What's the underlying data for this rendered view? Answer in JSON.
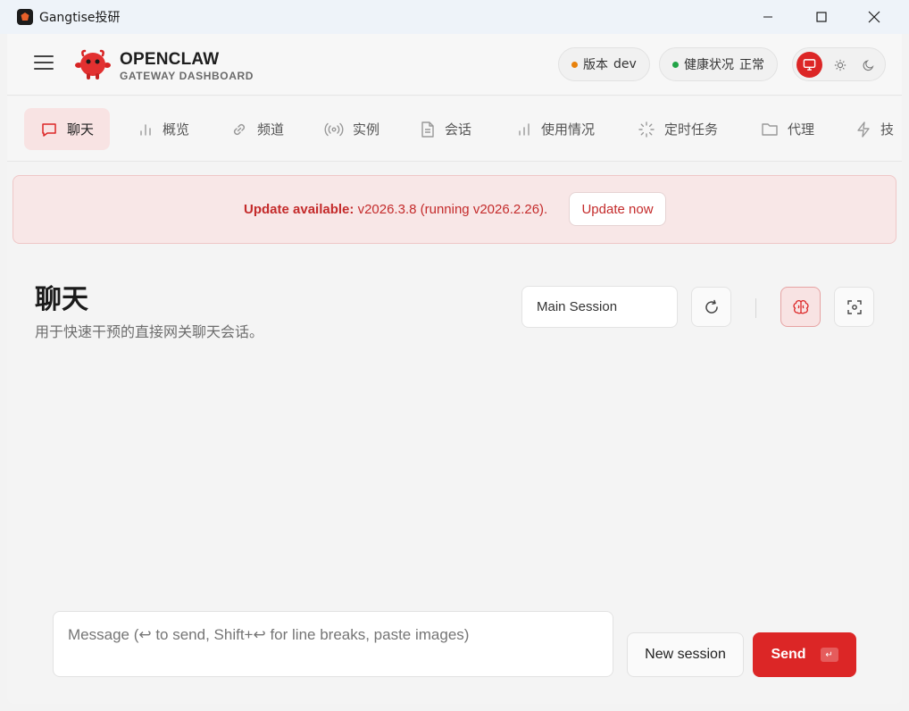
{
  "window": {
    "title": "Gangtise投研"
  },
  "brand": {
    "title": "OPENCLAW",
    "subtitle": "GATEWAY DASHBOARD"
  },
  "status": {
    "version_label": "版本",
    "version_value": "dev",
    "version_color": "#e8820c",
    "health_label": "健康状况",
    "health_value": "正常",
    "health_color": "#22a447"
  },
  "tabs": [
    {
      "label": "聊天",
      "icon": "message-icon",
      "active": true
    },
    {
      "label": "概览",
      "icon": "bar-chart-icon"
    },
    {
      "label": "频道",
      "icon": "link-icon"
    },
    {
      "label": "实例",
      "icon": "radio-icon"
    },
    {
      "label": "会话",
      "icon": "file-text-icon"
    },
    {
      "label": "使用情况",
      "icon": "bar-chart-icon"
    },
    {
      "label": "定时任务",
      "icon": "loader-icon"
    },
    {
      "label": "代理",
      "icon": "folder-icon"
    },
    {
      "label": "技",
      "icon": "zap-icon"
    }
  ],
  "banner": {
    "label": "Update available:",
    "text": "v2026.3.8 (running v2026.2.26).",
    "button": "Update now"
  },
  "page": {
    "title": "聊天",
    "subtitle": "用于快速干预的直接网关聊天会话。",
    "session_value": "Main Session"
  },
  "composer": {
    "placeholder": "Message (↩ to send, Shift+↩ for line breaks, paste images)",
    "new_session": "New session",
    "send": "Send",
    "send_kbd": "↵"
  },
  "colors": {
    "accent": "#dc2626"
  }
}
